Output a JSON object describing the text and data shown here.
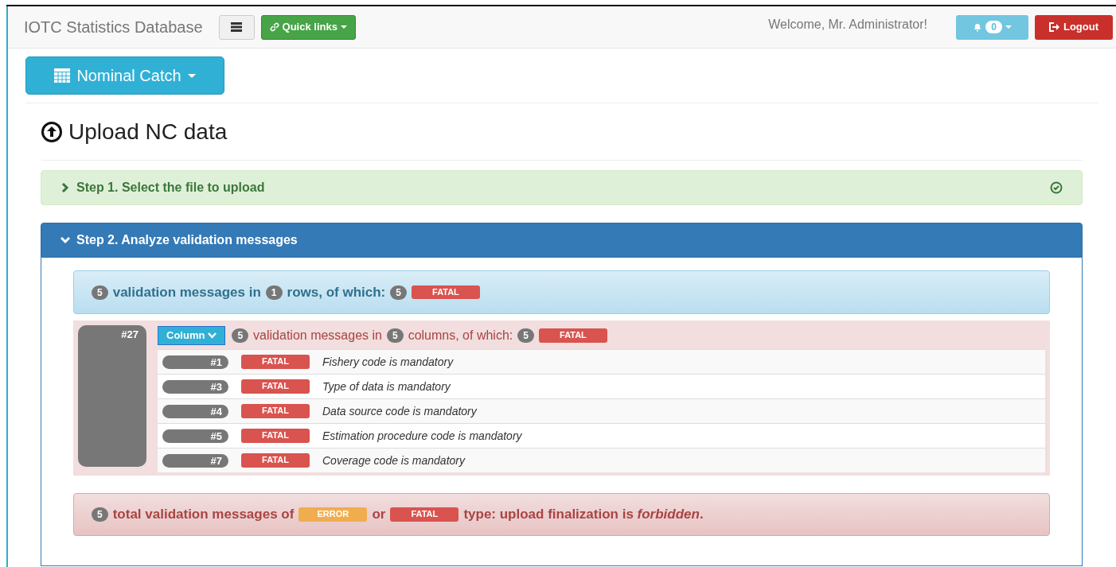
{
  "navbar": {
    "brand": "IOTC Statistics Database",
    "quick_links": "Quick links",
    "welcome": "Welcome, Mr. Administrator!",
    "notifications": "0",
    "logout": "Logout"
  },
  "section_button": "Nominal Catch",
  "page_title": "Upload NC data",
  "steps": [
    {
      "title": "Step 1. Select the file to upload",
      "expanded": false,
      "completed": true
    },
    {
      "title": "Step 2. Analyze validation messages",
      "expanded": true,
      "completed": false
    }
  ],
  "summary": [
    {
      "kind": "count",
      "text": "5"
    },
    {
      "kind": "text",
      "text": "validation messages in"
    },
    {
      "kind": "count",
      "text": "1"
    },
    {
      "kind": "text",
      "text": "rows, of which:"
    },
    {
      "kind": "count",
      "text": "5"
    },
    {
      "kind": "fatal",
      "text": "FATAL"
    }
  ],
  "row_group": {
    "row": "#27",
    "column_button": "Column",
    "summary": [
      {
        "kind": "count",
        "text": "5"
      },
      {
        "kind": "text",
        "text": "validation messages in"
      },
      {
        "kind": "count",
        "text": "5"
      },
      {
        "kind": "text",
        "text": "columns, of which:"
      },
      {
        "kind": "count",
        "text": "5"
      },
      {
        "kind": "fatal",
        "text": "FATAL"
      }
    ],
    "messages": [
      {
        "column": "#1",
        "kind": "fatal",
        "level": "FATAL",
        "text": "Fishery code is mandatory"
      },
      {
        "column": "#3",
        "kind": "fatal",
        "level": "FATAL",
        "text": "Type of data is mandatory"
      },
      {
        "column": "#4",
        "kind": "fatal",
        "level": "FATAL",
        "text": "Data source code is mandatory"
      },
      {
        "column": "#5",
        "kind": "fatal",
        "level": "FATAL",
        "text": "Estimation procedure code is mandatory"
      },
      {
        "column": "#7",
        "kind": "fatal",
        "level": "FATAL",
        "text": "Coverage code is mandatory"
      }
    ]
  },
  "total": [
    {
      "kind": "count",
      "text": "5"
    },
    {
      "kind": "text",
      "text": "total validation messages of"
    },
    {
      "kind": "error",
      "text": "ERROR"
    },
    {
      "kind": "text",
      "text": "or"
    },
    {
      "kind": "fatal",
      "text": "FATAL"
    },
    {
      "kind": "text",
      "text": "type: upload finalization is *forbidden*."
    }
  ]
}
